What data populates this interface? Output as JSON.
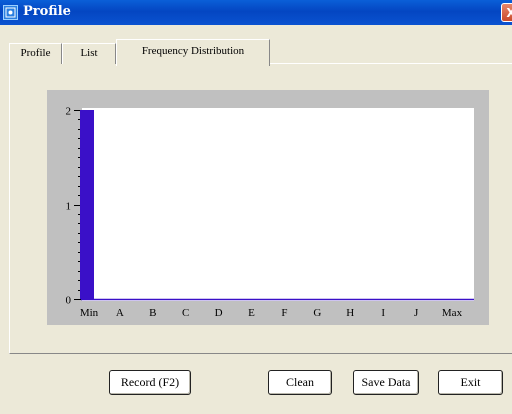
{
  "window": {
    "title": "Profile",
    "close_glyph": "X"
  },
  "tabs": [
    {
      "label": "Profile",
      "active": false
    },
    {
      "label": "List",
      "active": false
    },
    {
      "label": "Frequency Distribution",
      "active": true
    }
  ],
  "chart_data": {
    "type": "bar",
    "categories": [
      "Min",
      "A",
      "B",
      "C",
      "D",
      "E",
      "F",
      "G",
      "H",
      "I",
      "J",
      "Max"
    ],
    "values": [
      2,
      0,
      0,
      0,
      0,
      0,
      0,
      0,
      0,
      0,
      0,
      0
    ],
    "ylim": [
      0,
      2
    ],
    "yticks": [
      0,
      1,
      2
    ],
    "bar_color": "#3a10c8",
    "grid": false
  },
  "buttons": {
    "record": "Record (F2)",
    "clean": "Clean",
    "save": "Save Data",
    "exit": "Exit"
  }
}
